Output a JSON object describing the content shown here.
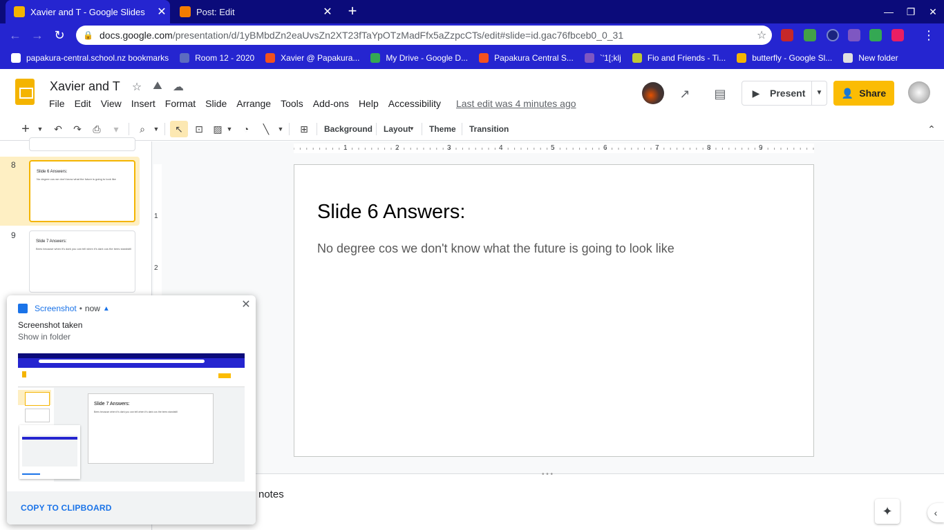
{
  "tabs": [
    {
      "title": "Xavier and T - Google Slides",
      "favicon_color": "#f4b400",
      "active": true
    },
    {
      "title": "Post: Edit",
      "favicon_color": "#f57c00",
      "active": false
    }
  ],
  "toolbar": {
    "url_host": "docs.google.com",
    "url_path": "/presentation/d/1yBMbdZn2eaUvsZn2XT23fTaYpOTzMadFfx5aZzpcCTs/edit#slide=id.gac76fbceb0_0_31"
  },
  "bookmarks": [
    {
      "label": "papakura-central.school.nz bookmarks",
      "color": "#ffffff"
    },
    {
      "label": "Room 12 - 2020",
      "color": "#5c6bc0"
    },
    {
      "label": "Xavier @ Papakura...",
      "color": "#f4511e"
    },
    {
      "label": "My Drive - Google D...",
      "color": "#34a853"
    },
    {
      "label": "Papakura Central S...",
      "color": "#f4511e"
    },
    {
      "label": "`'1[;klj",
      "color": "#7e57c2"
    },
    {
      "label": "Fio and Friends - Ti...",
      "color": "#c0ca33"
    },
    {
      "label": "butterfly - Google Sl...",
      "color": "#f4b400"
    },
    {
      "label": "New folder",
      "color": "#e0e0e0"
    }
  ],
  "doc": {
    "title": "Xavier and T",
    "menu": [
      "File",
      "Edit",
      "View",
      "Insert",
      "Format",
      "Slide",
      "Arrange",
      "Tools",
      "Add-ons",
      "Help",
      "Accessibility"
    ],
    "last_edit": "Last edit was 4 minutes ago",
    "present_label": "Present",
    "share_label": "Share"
  },
  "edit_toolbar": {
    "background": "Background",
    "layout": "Layout",
    "theme": "Theme",
    "transition": "Transition"
  },
  "ruler": {
    "h_labels": [
      "1",
      "2",
      "3",
      "4",
      "5",
      "6",
      "7",
      "8",
      "9"
    ],
    "v_labels": [
      "1",
      "2"
    ]
  },
  "filmstrip": [
    {
      "number": "8",
      "title": "Slide 6 Answers:",
      "body": "No degree cos we don't know what the future is going to look like",
      "selected": true
    },
    {
      "number": "9",
      "title": "Slide 7 Answers:",
      "body": "Bees because when it's dark you can tell when it's dark cos the bees standstill",
      "selected": false
    }
  ],
  "slide": {
    "title": "Slide 6 Answers:",
    "body": "No degree cos we don't know what the future is going to look like"
  },
  "notes": {
    "label": "notes"
  },
  "notification": {
    "app": "Screenshot",
    "time": "now",
    "title": "Screenshot taken",
    "subtitle": "Show in folder",
    "action": "COPY TO CLIPBOARD",
    "preview_slide_title": "Slide 7 Answers:",
    "preview_slide_body": "Bees because when it's dark you can tell when it's dark cos the bees standstill"
  },
  "colors": {
    "tab_strip": "#0b0b7a",
    "toolbar": "#2525d0",
    "accent_yellow": "#fbbc04",
    "selection": "#feefc3",
    "link_blue": "#1a73e8"
  }
}
